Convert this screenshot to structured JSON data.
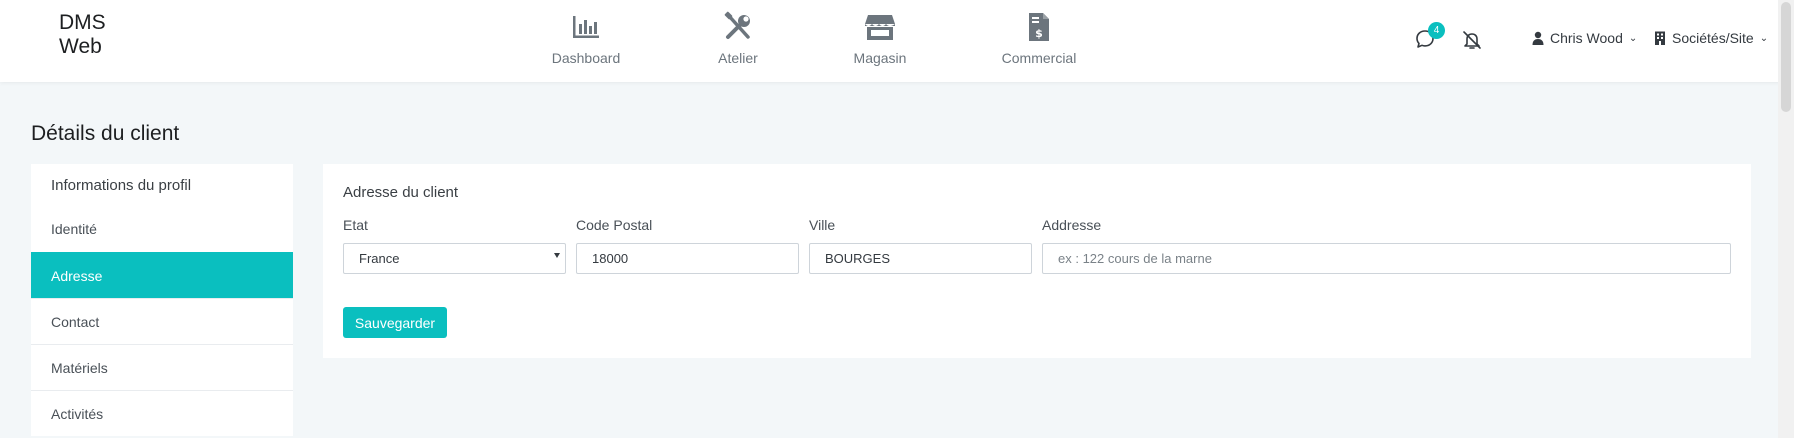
{
  "brand": {
    "line1": "DMS",
    "line2": "Web"
  },
  "nav": [
    {
      "label": "Dashboard",
      "icon": "bar-chart-icon"
    },
    {
      "label": "Atelier",
      "icon": "wrench-screwdriver-icon"
    },
    {
      "label": "Magasin",
      "icon": "shop-icon"
    },
    {
      "label": "Commercial",
      "icon": "invoice-dollar-icon"
    }
  ],
  "header": {
    "messages_count": "4",
    "user_name": "Chris Wood",
    "site_label": "Sociétés/Site"
  },
  "page": {
    "title": "Détails du client"
  },
  "sidebar": {
    "heading": "Informations du profil",
    "items": [
      {
        "label": "Identité"
      },
      {
        "label": "Adresse"
      },
      {
        "label": "Contact"
      },
      {
        "label": "Matériels"
      },
      {
        "label": "Activités"
      }
    ],
    "active": "Adresse"
  },
  "card": {
    "title": "Adresse du client",
    "fields": {
      "etat": {
        "label": "Etat",
        "value": "France"
      },
      "code_postal": {
        "label": "Code Postal",
        "value": "18000"
      },
      "ville": {
        "label": "Ville",
        "value": "BOURGES"
      },
      "adresse": {
        "label": "Addresse",
        "value": "",
        "placeholder": "ex : 122 cours de la marne"
      }
    },
    "save_label": "Sauvegarder"
  },
  "colors": {
    "accent": "#0abfbf",
    "background": "#f3f7f9",
    "nav_icon": "#6c757d"
  }
}
